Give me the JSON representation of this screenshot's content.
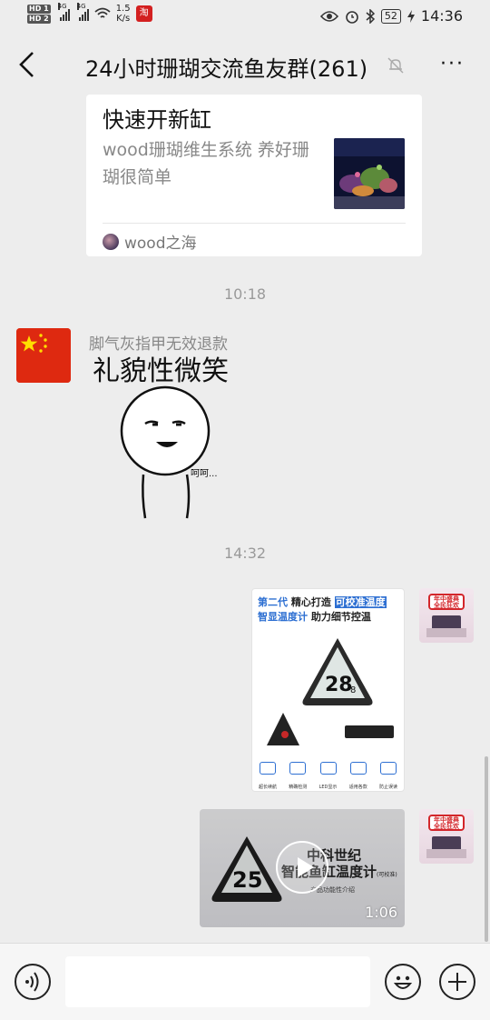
{
  "status_bar": {
    "hd1": "HD 1",
    "hd2": "HD 2",
    "net1": "4G",
    "net2": "4G",
    "speed_value": "1.5",
    "speed_unit": "K/s",
    "battery": "52",
    "time": "14:36",
    "icons": [
      "eye-icon",
      "alarm-icon",
      "bluetooth-icon",
      "charging-icon"
    ]
  },
  "header": {
    "back_icon": "chevron-left-icon",
    "title": "24小时珊瑚交流鱼友群(261)",
    "mute_icon": "bell-muted-icon",
    "more_label": "···"
  },
  "messages": {
    "card": {
      "title": "快速开新缸",
      "description": "wood珊瑚维生系统 养好珊瑚很简单",
      "source": "wood之海"
    },
    "time1": "10:18",
    "sticker_msg": {
      "sender": "脚气灰指甲无效退款",
      "sticker_text": "礼貌性微笑",
      "sticker_small": "呵呵..."
    },
    "time2": "14:32",
    "product_image": {
      "line1_prefix": "第二代",
      "line1_mid": "精心打造",
      "line1_hl": "可校准温度",
      "line2_prefix": "智显温度计",
      "line2_suffix": "助力细节控温",
      "display_value": "28",
      "display_unit": "8",
      "icon_labels": [
        "超长续航",
        "精确检测",
        "LED显示",
        "适用各款",
        "防止误读"
      ]
    },
    "video": {
      "title_line1": "中科世纪",
      "title_line2": "智能鱼缸温度计",
      "title_note": "(可校准)",
      "subtitle": "产品功能性介绍",
      "display_value": "25",
      "duration": "1:06"
    }
  },
  "avatar_right": {
    "badge": "年中盛典 全民狂欢"
  },
  "input_bar": {
    "placeholder": "",
    "voice_icon": "voice-icon",
    "emoji_icon": "emoji-icon",
    "plus_icon": "plus-icon"
  }
}
